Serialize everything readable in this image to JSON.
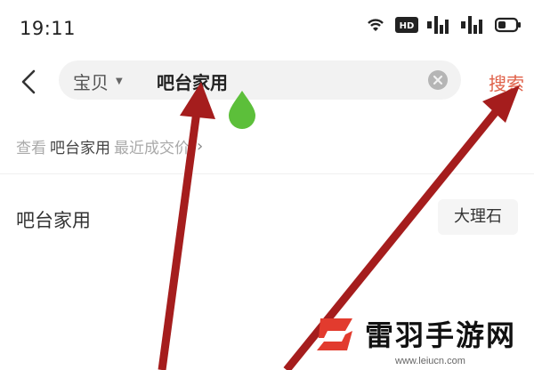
{
  "status_bar": {
    "time": "19:11",
    "icons": [
      "wifi-icon",
      "hd-icon",
      "signal-icon-1",
      "signal-icon-2",
      "battery-icon"
    ]
  },
  "search": {
    "back_icon": "chevron-left-icon",
    "scope_label": "宝贝",
    "query": "吧台家用",
    "clear_icon": "clear-circle-icon",
    "submit_label": "搜索"
  },
  "price_hint": {
    "prefix": "查看",
    "keyword": "吧台家用",
    "suffix": "最近成交价"
  },
  "suggestions": [
    {
      "label": "吧台家用",
      "tag": "大理石"
    }
  ],
  "watermark": {
    "brand": "雷羽手游网",
    "url": "www.leiucn.com"
  },
  "colors": {
    "accent": "#e0624a",
    "arrow": "#a51d1d",
    "drop": "#5cbf3a"
  }
}
